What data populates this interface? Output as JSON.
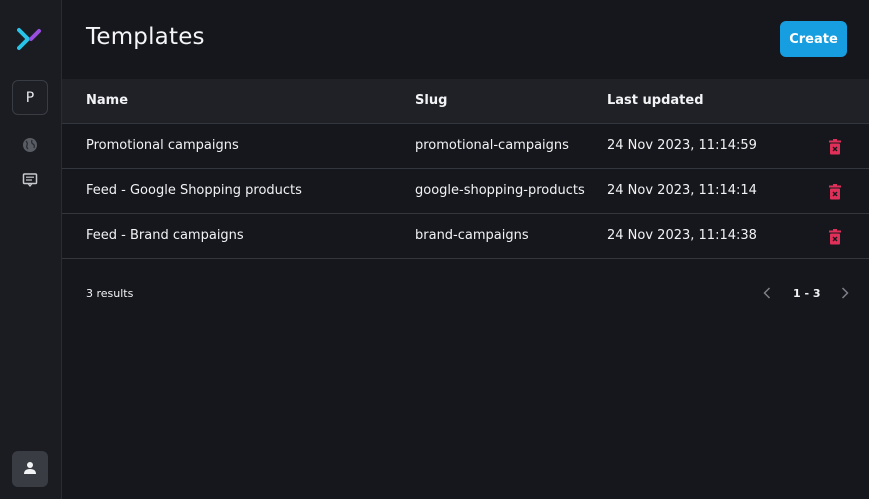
{
  "sidebar": {
    "logo_icon": "brand-logo-icon",
    "project_initial": "P",
    "nav_items": [
      {
        "icon": "globe-icon"
      },
      {
        "icon": "message-board-icon"
      }
    ],
    "user_icon": "user-icon"
  },
  "header": {
    "title": "Templates",
    "create_label": "Create",
    "accent_color": "#179ee0"
  },
  "table": {
    "columns": [
      "Name",
      "Slug",
      "Last updated"
    ],
    "rows": [
      {
        "name": "Promotional campaigns",
        "slug": "promotional-campaigns",
        "updated": "24 Nov 2023, 11:14:59"
      },
      {
        "name": "Feed - Google Shopping products",
        "slug": "google-shopping-products",
        "updated": "24 Nov 2023, 11:14:14"
      },
      {
        "name": "Feed - Brand campaigns",
        "slug": "brand-campaigns",
        "updated": "24 Nov 2023, 11:14:38"
      }
    ],
    "delete_icon": "trash-icon",
    "delete_color": "#e0305a"
  },
  "footer": {
    "result_count": "3 results",
    "page_range": "1 - 3"
  }
}
